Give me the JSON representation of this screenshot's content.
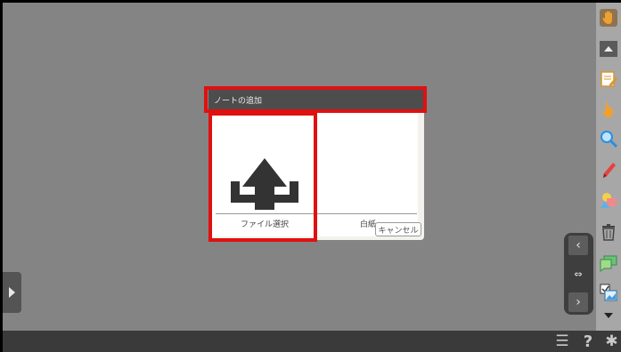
{
  "dialog": {
    "title": "ノートの追加",
    "options": [
      {
        "label": "ファイル選択",
        "icon": "upload-icon"
      },
      {
        "label": "白紙",
        "icon": "blank-page"
      }
    ],
    "cancel_label": "キャンセル"
  },
  "sidebar": {
    "tools": [
      "hand-icon",
      "scroll-up-icon",
      "note-edit-icon",
      "hand-pointer-icon",
      "magnifier-icon",
      "pen-icon",
      "shapes-icon",
      "trash-icon",
      "comment-icon",
      "image-check-icon",
      "scroll-down-icon"
    ]
  },
  "nav": {
    "prev": "‹",
    "fit": "⇔",
    "next": "›"
  },
  "bottom": {
    "list_icon": "☰",
    "help_icon": "?",
    "settings_icon": "✱"
  },
  "colors": {
    "canvas": "#848484",
    "highlight": "#e01010",
    "header": "#4d4d4d",
    "sidebar": "#a7a7a7",
    "upload_icon": "#333333"
  }
}
